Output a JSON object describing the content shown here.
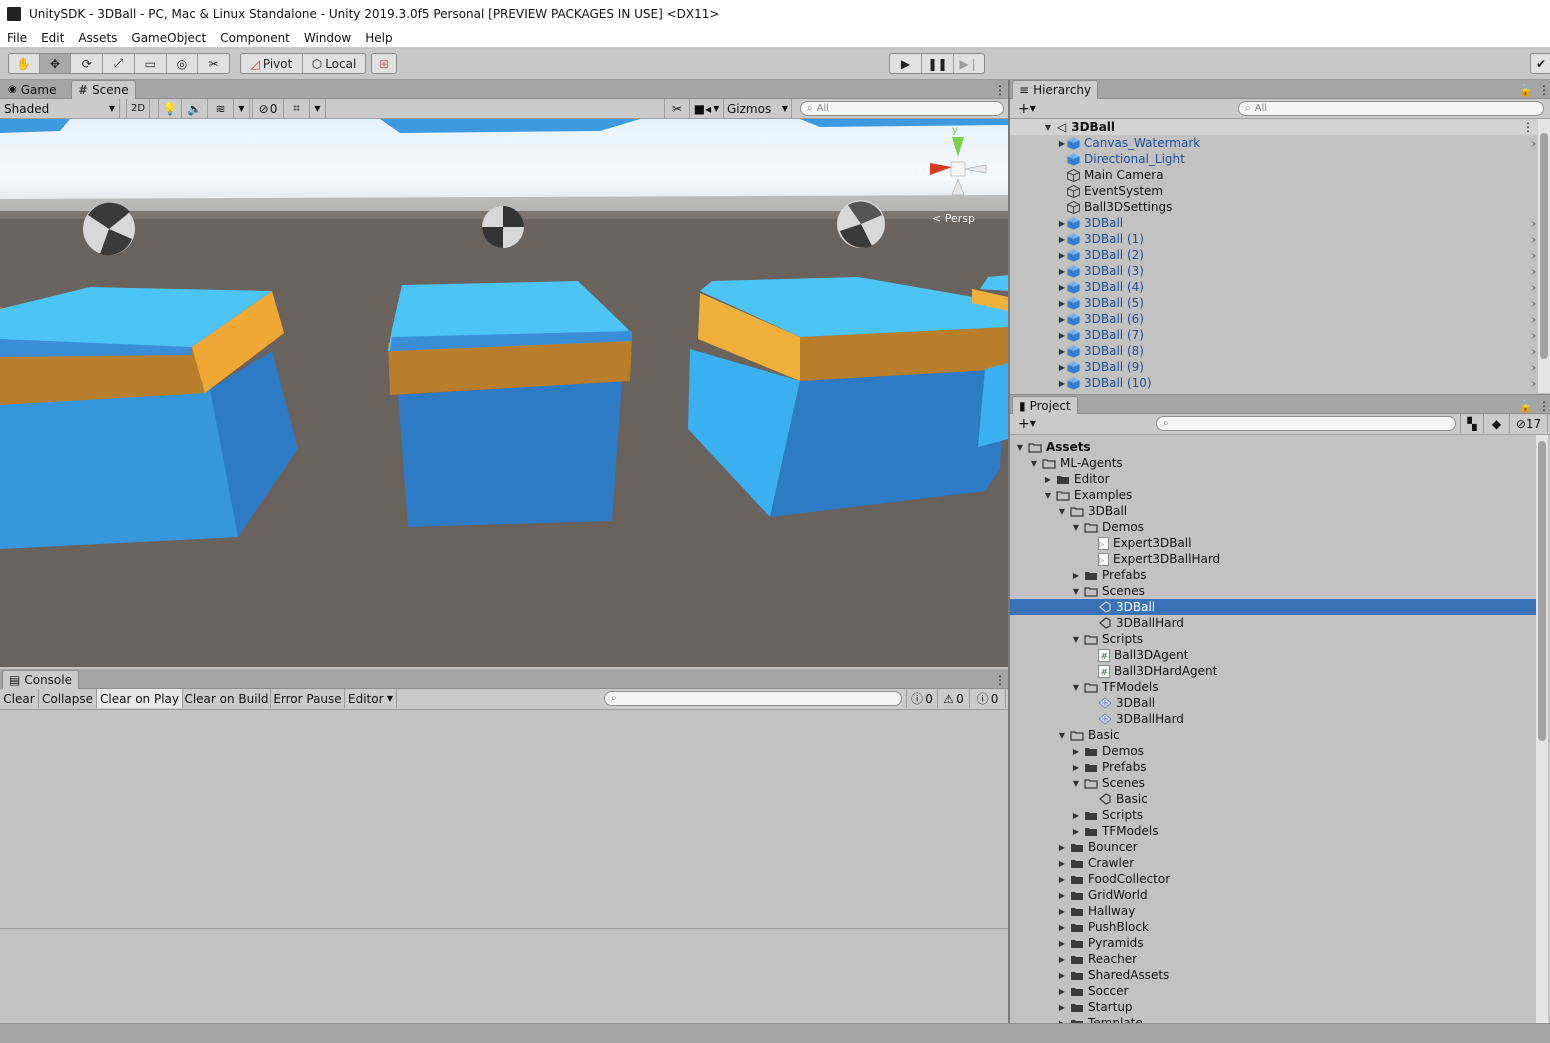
{
  "window": {
    "title": "UnitySDK - 3DBall - PC, Mac & Linux Standalone - Unity 2019.3.0f5 Personal [PREVIEW PACKAGES IN USE] <DX11>"
  },
  "menu": [
    "File",
    "Edit",
    "Assets",
    "GameObject",
    "Component",
    "Window",
    "Help"
  ],
  "toolbar": {
    "pivot": "Pivot",
    "local": "Local"
  },
  "scene_panel": {
    "tabs": [
      "Game",
      "Scene"
    ],
    "shading": "Shaded",
    "mode_2d": "2D",
    "hidden_count": "0",
    "gizmos": "Gizmos",
    "search_placeholder": "All",
    "persp_label": "Persp",
    "axis_y": "y",
    "axis_x": "x"
  },
  "console": {
    "tab": "Console",
    "buttons": [
      "Clear",
      "Collapse",
      "Clear on Play",
      "Clear on Build",
      "Error Pause",
      "Editor"
    ],
    "counts": {
      "info": "0",
      "warning": "0",
      "error": "0"
    }
  },
  "hierarchy": {
    "tab": "Hierarchy",
    "search_placeholder": "All",
    "scene": "3DBall",
    "items": [
      {
        "label": "Canvas_Watermark",
        "prefab": true,
        "expandable": true
      },
      {
        "label": "Directional_Light",
        "prefab": true,
        "expandable": false
      },
      {
        "label": "Main Camera",
        "prefab": false,
        "expandable": false
      },
      {
        "label": "EventSystem",
        "prefab": false,
        "expandable": false
      },
      {
        "label": "Ball3DSettings",
        "prefab": false,
        "expandable": false
      },
      {
        "label": "3DBall",
        "prefab": true,
        "expandable": true
      },
      {
        "label": "3DBall (1)",
        "prefab": true,
        "expandable": true
      },
      {
        "label": "3DBall (2)",
        "prefab": true,
        "expandable": true
      },
      {
        "label": "3DBall (3)",
        "prefab": true,
        "expandable": true
      },
      {
        "label": "3DBall (4)",
        "prefab": true,
        "expandable": true
      },
      {
        "label": "3DBall (5)",
        "prefab": true,
        "expandable": true
      },
      {
        "label": "3DBall (6)",
        "prefab": true,
        "expandable": true
      },
      {
        "label": "3DBall (7)",
        "prefab": true,
        "expandable": true
      },
      {
        "label": "3DBall (8)",
        "prefab": true,
        "expandable": true
      },
      {
        "label": "3DBall (9)",
        "prefab": true,
        "expandable": true
      },
      {
        "label": "3DBall (10)",
        "prefab": true,
        "expandable": true
      }
    ]
  },
  "project": {
    "tab": "Project",
    "hidden_packages": "17",
    "tree": [
      {
        "label": "Assets",
        "depth": 0,
        "kind": "folder",
        "open": true,
        "bold": true
      },
      {
        "label": "ML-Agents",
        "depth": 1,
        "kind": "folder",
        "open": true
      },
      {
        "label": "Editor",
        "depth": 2,
        "kind": "folder",
        "open": false
      },
      {
        "label": "Examples",
        "depth": 2,
        "kind": "folder",
        "open": true
      },
      {
        "label": "3DBall",
        "depth": 3,
        "kind": "folder",
        "open": true
      },
      {
        "label": "Demos",
        "depth": 4,
        "kind": "folder",
        "open": true
      },
      {
        "label": "Expert3DBall",
        "depth": 5,
        "kind": "demo"
      },
      {
        "label": "Expert3DBallHard",
        "depth": 5,
        "kind": "demo"
      },
      {
        "label": "Prefabs",
        "depth": 4,
        "kind": "folder",
        "open": false
      },
      {
        "label": "Scenes",
        "depth": 4,
        "kind": "folder",
        "open": true
      },
      {
        "label": "3DBall",
        "depth": 5,
        "kind": "scene",
        "selected": true
      },
      {
        "label": "3DBallHard",
        "depth": 5,
        "kind": "scene"
      },
      {
        "label": "Scripts",
        "depth": 4,
        "kind": "folder",
        "open": true
      },
      {
        "label": "Ball3DAgent",
        "depth": 5,
        "kind": "script"
      },
      {
        "label": "Ball3DHardAgent",
        "depth": 5,
        "kind": "script"
      },
      {
        "label": "TFModels",
        "depth": 4,
        "kind": "folder",
        "open": true
      },
      {
        "label": "3DBall",
        "depth": 5,
        "kind": "model"
      },
      {
        "label": "3DBallHard",
        "depth": 5,
        "kind": "model"
      },
      {
        "label": "Basic",
        "depth": 3,
        "kind": "folder",
        "open": true
      },
      {
        "label": "Demos",
        "depth": 4,
        "kind": "folder",
        "open": false
      },
      {
        "label": "Prefabs",
        "depth": 4,
        "kind": "folder",
        "open": false
      },
      {
        "label": "Scenes",
        "depth": 4,
        "kind": "folder",
        "open": true
      },
      {
        "label": "Basic",
        "depth": 5,
        "kind": "scene"
      },
      {
        "label": "Scripts",
        "depth": 4,
        "kind": "folder",
        "open": false
      },
      {
        "label": "TFModels",
        "depth": 4,
        "kind": "folder",
        "open": false
      },
      {
        "label": "Bouncer",
        "depth": 3,
        "kind": "folder",
        "open": false
      },
      {
        "label": "Crawler",
        "depth": 3,
        "kind": "folder",
        "open": false
      },
      {
        "label": "FoodCollector",
        "depth": 3,
        "kind": "folder",
        "open": false
      },
      {
        "label": "GridWorld",
        "depth": 3,
        "kind": "folder",
        "open": false
      },
      {
        "label": "Hallway",
        "depth": 3,
        "kind": "folder",
        "open": false
      },
      {
        "label": "PushBlock",
        "depth": 3,
        "kind": "folder",
        "open": false
      },
      {
        "label": "Pyramids",
        "depth": 3,
        "kind": "folder",
        "open": false
      },
      {
        "label": "Reacher",
        "depth": 3,
        "kind": "folder",
        "open": false
      },
      {
        "label": "SharedAssets",
        "depth": 3,
        "kind": "folder",
        "open": false
      },
      {
        "label": "Soccer",
        "depth": 3,
        "kind": "folder",
        "open": false
      },
      {
        "label": "Startup",
        "depth": 3,
        "kind": "folder",
        "open": false
      },
      {
        "label": "Template",
        "depth": 3,
        "kind": "folder",
        "open": false
      }
    ]
  },
  "colors": {
    "selection": "#3a72b8",
    "prefab_text": "#1a4d9a",
    "cube_top": "#4cc4f5",
    "cube_side": "#2c7bc4",
    "cube_band": "#f0a834",
    "ground": "#6a625c"
  }
}
